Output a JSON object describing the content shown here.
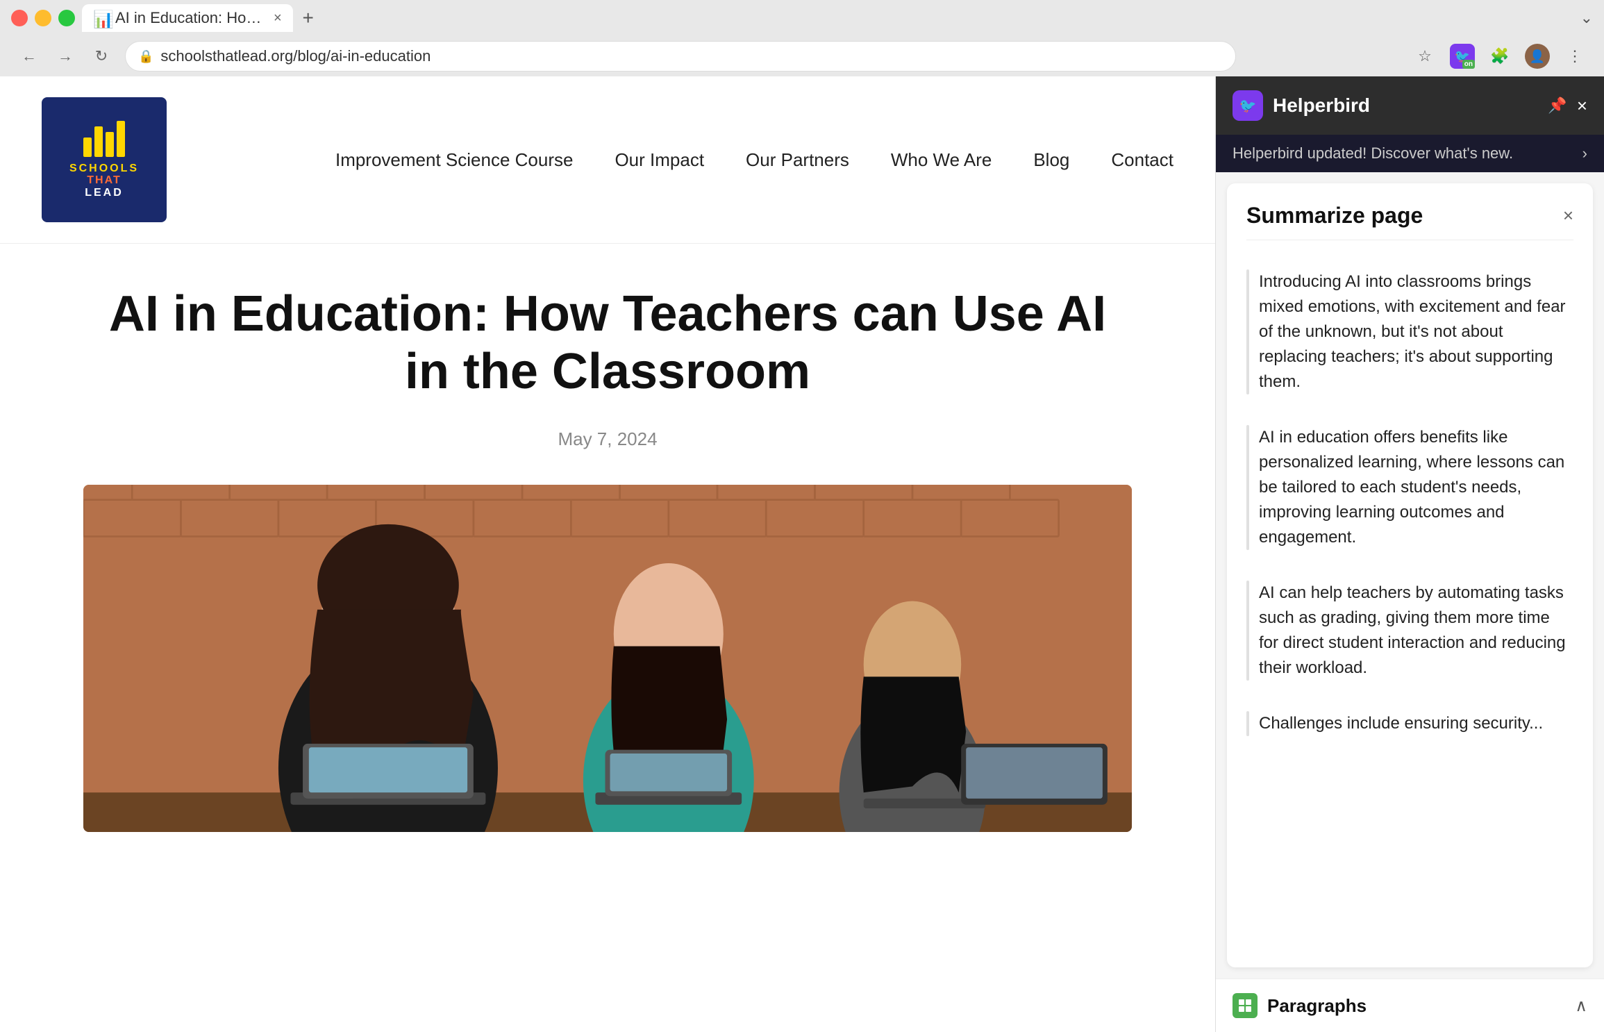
{
  "browser": {
    "tab_title": "AI in Education: How Teacher...",
    "tab_favicon": "📊",
    "new_tab_btn": "+",
    "address": "schoolsthatlead.org/blog/ai-in-education",
    "back_label": "←",
    "forward_label": "→",
    "reload_label": "↻",
    "bookmark_label": "☆",
    "dropdown_label": "≡"
  },
  "site": {
    "logo": {
      "line1": "SCHOOLS",
      "line2_colored": "THAT",
      "line3": "LEAD"
    },
    "nav": {
      "link1": "Improvement Science Course",
      "link2": "Our Impact",
      "link3": "Our Partners",
      "link4": "Who We Are",
      "link5": "Blog",
      "link6": "Contact"
    },
    "article": {
      "title": "AI in Education: How Teachers can Use AI in the Classroom",
      "date": "May 7, 2024"
    }
  },
  "helperbird": {
    "panel_title": "Helperbird",
    "update_text": "Helperbird updated! Discover what's new.",
    "summarize_title": "Summarize page",
    "close_label": "×",
    "summaries": [
      {
        "text": "Introducing AI into classrooms brings mixed emotions, with excitement and fear of the unknown, but it's not about replacing teachers; it's about supporting them."
      },
      {
        "text": "AI in education offers benefits like personalized learning, where lessons can be tailored to each student's needs, improving learning outcomes and engagement."
      },
      {
        "text": "AI can help teachers by automating tasks such as grading, giving them more time for direct student interaction and reducing their workload."
      },
      {
        "text": "Challenges include ensuring security..."
      }
    ],
    "footer_label": "Paragraphs",
    "footer_icon": "⊞"
  }
}
